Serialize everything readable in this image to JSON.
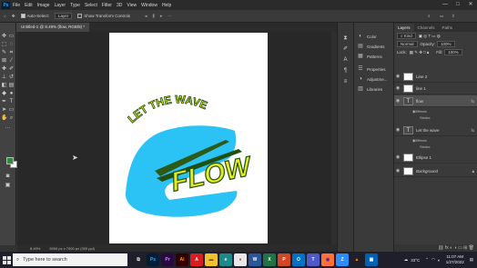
{
  "app": {
    "logo_label": "Ps",
    "menu": [
      "File",
      "Edit",
      "Image",
      "Layer",
      "Type",
      "Select",
      "Filter",
      "3D",
      "View",
      "Window",
      "Help"
    ],
    "window_controls": [
      "—",
      "□",
      "✕"
    ]
  },
  "options_bar": {
    "auto_select_label": "Auto-Select:",
    "auto_select_value": "Layer",
    "show_transform_label": "Show Transform Controls"
  },
  "document": {
    "tab_title": "Untitled-1 @ 8.49% (flow, RGB/8) *",
    "zoom": "8.49%",
    "dimensions": "5000 px x 7000 px (300 ppi)"
  },
  "artwork": {
    "arc_text": "LET THE WAVE",
    "flow_text": "FLOW",
    "colors": {
      "wave": "#2bc2f5",
      "text_fill": "#e6ea1e",
      "text_stroke": "#1f4f12",
      "stripe": "#2e5a17",
      "background": "#ffffff"
    }
  },
  "colors": {
    "foreground": "#2e8b3a",
    "background": "#ffffff"
  },
  "mid_panel": {
    "items": [
      {
        "icon": "color-icon",
        "label": "Color"
      },
      {
        "icon": "gradients-icon",
        "label": "Gradients"
      },
      {
        "icon": "patterns-icon",
        "label": "Patterns"
      },
      {
        "icon": "properties-icon",
        "label": "Properties"
      },
      {
        "icon": "adjustments-icon",
        "label": "Adjustme..."
      },
      {
        "icon": "libraries-icon",
        "label": "Libraries"
      }
    ]
  },
  "layers_panel": {
    "tabs": [
      "Layers",
      "Channels",
      "Paths"
    ],
    "filter_kind": "Kind",
    "blend_mode": "Normal",
    "opacity_label": "Opacity:",
    "opacity_value": "100%",
    "lock_label": "Lock:",
    "fill_label": "Fill:",
    "fill_value": "100%",
    "layers": [
      {
        "name": "Line 2",
        "type": "pixel"
      },
      {
        "name": "line 1",
        "type": "pixel"
      },
      {
        "name": "flow",
        "type": "text",
        "effects": [
          "Effects",
          "Stroke"
        ],
        "selected": true
      },
      {
        "name": "Let the wave",
        "type": "text",
        "effects": [
          "Effects",
          "Stroke"
        ]
      },
      {
        "name": "Ellipse 1",
        "type": "shape"
      },
      {
        "name": "Background",
        "type": "pixel"
      }
    ],
    "fx_label": "fx"
  },
  "taskbar": {
    "search_placeholder": "Type here to search",
    "apps": [
      {
        "icon": "task-view-icon",
        "label": "⧉",
        "bg": "#1e1f2a",
        "fg": "#ddd"
      },
      {
        "icon": "photoshop-taskbar-icon",
        "label": "Ps",
        "bg": "#001e36",
        "fg": "#31a8ff"
      },
      {
        "icon": "premiere-icon",
        "label": "Pr",
        "bg": "#2a0a3e",
        "fg": "#b993ff"
      },
      {
        "icon": "illustrator-icon",
        "label": "Ai",
        "bg": "#330000",
        "fg": "#ff9a00"
      },
      {
        "icon": "acrobat-icon",
        "label": "A",
        "bg": "#d71e1e",
        "fg": "#ffffff"
      },
      {
        "icon": "file-explorer-icon",
        "label": "▬",
        "bg": "#f2c22e",
        "fg": "#6b4c00"
      },
      {
        "icon": "edge-icon",
        "label": "e",
        "bg": "#1a8a8a",
        "fg": "#ffffff"
      },
      {
        "icon": "chrome-icon",
        "label": "●",
        "bg": "#e8e8e8",
        "fg": "#db4437"
      },
      {
        "icon": "word-icon",
        "label": "W",
        "bg": "#2b579a",
        "fg": "#ffffff"
      },
      {
        "icon": "excel-icon",
        "label": "X",
        "bg": "#217346",
        "fg": "#ffffff"
      },
      {
        "icon": "powerpoint-icon",
        "label": "P",
        "bg": "#d24726",
        "fg": "#ffffff"
      },
      {
        "icon": "outlook-icon",
        "label": "O",
        "bg": "#0072c6",
        "fg": "#ffffff"
      },
      {
        "icon": "teams-icon",
        "label": "T",
        "bg": "#5059c9",
        "fg": "#ffffff"
      },
      {
        "icon": "firefox-icon",
        "label": "◉",
        "bg": "#ff7139",
        "fg": "#5b1d9a"
      },
      {
        "icon": "zoom-icon",
        "label": "Z",
        "bg": "#2d8cff",
        "fg": "#ffffff"
      },
      {
        "icon": "vlc-icon",
        "label": "▲",
        "bg": "#1e1f2a",
        "fg": "#ff8800"
      },
      {
        "icon": "photos-icon",
        "label": "▣",
        "bg": "#0063b1",
        "fg": "#ffffff"
      }
    ],
    "temperature": "33°C",
    "time": "11:07 AM",
    "date": "1/27/2022"
  }
}
